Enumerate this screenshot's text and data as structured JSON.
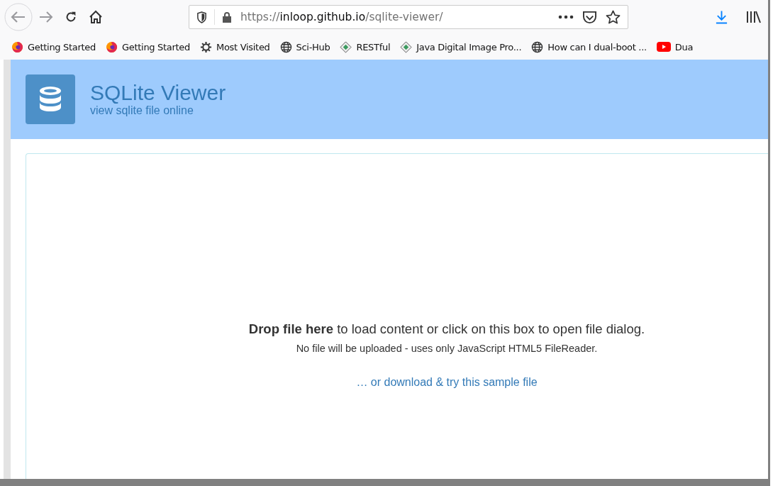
{
  "browser": {
    "url": {
      "scheme": "https://",
      "host": "inloop.github.io",
      "path": "/sqlite-viewer/"
    },
    "bookmarks": [
      {
        "label": "Getting Started",
        "kind": "firefox"
      },
      {
        "label": "Getting Started",
        "kind": "firefox"
      },
      {
        "label": "Most Visited",
        "kind": "gear"
      },
      {
        "label": "Sci-Hub",
        "kind": "globe"
      },
      {
        "label": "RESTful",
        "kind": "diamond"
      },
      {
        "label": "Java Digital Image Pro...",
        "kind": "diamond"
      },
      {
        "label": "How can I dual-boot ...",
        "kind": "globe"
      },
      {
        "label": "Dua",
        "kind": "video"
      }
    ]
  },
  "header": {
    "title": "SQLite Viewer",
    "subtitle": "view sqlite file online"
  },
  "dropzone": {
    "headline": "**Drop file here** to load content or click on this box to open file dialog.",
    "note": "No file will be uploaded - uses only JavaScript HTML5 FileReader.",
    "sample_link": "… or download & try this sample file"
  }
}
